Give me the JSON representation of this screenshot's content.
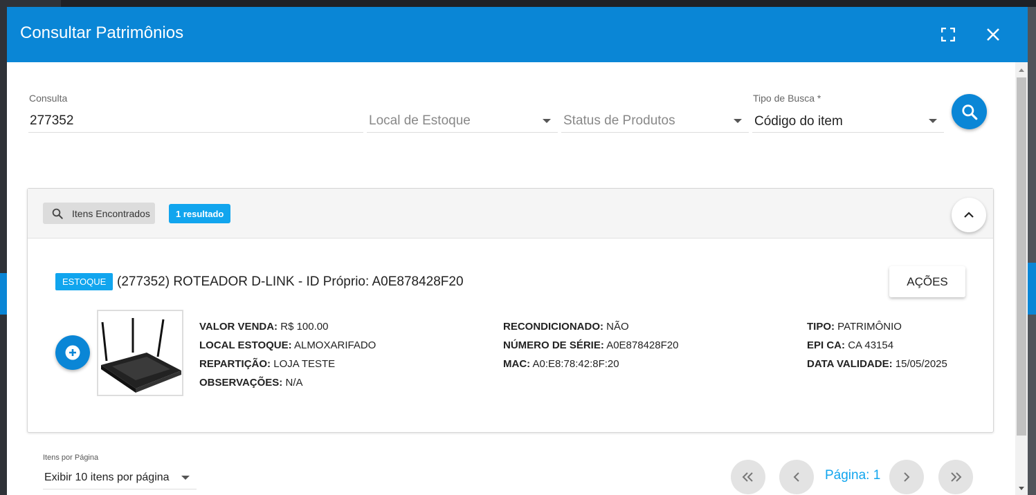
{
  "header": {
    "title": "Consultar Patrimônios",
    "fullscreen_icon": "fullscreen-icon",
    "close_icon": "close-icon",
    "color": "#0a86d6"
  },
  "search": {
    "consulta_label": "Consulta",
    "consulta_value": "277352",
    "local_estoque_placeholder": "Local de Estoque",
    "status_produtos_placeholder": "Status de Produtos",
    "tipo_busca_label": "Tipo de Busca *",
    "tipo_busca_value": "Código do item",
    "search_icon": "search-icon"
  },
  "results": {
    "found_label": "Itens Encontrados",
    "count_label": "1 resultado",
    "accent": "#11a5ee",
    "items": [
      {
        "badge": "ESTOQUE",
        "title": "(277352) ROTEADOR D-LINK - ID Próprio: A0E878428F20",
        "actions_label": "AÇÕES",
        "col1": [
          {
            "key": "VALOR VENDA:",
            "value": "R$ 100.00"
          },
          {
            "key": "LOCAL ESTOQUE:",
            "value": "ALMOXARIFADO"
          },
          {
            "key": "REPARTIÇÃO:",
            "value": "LOJA TESTE"
          },
          {
            "key": "OBSERVAÇÕES:",
            "value": "N/A"
          }
        ],
        "col2": [
          {
            "key": "RECONDICIONADO:",
            "value": "NÃO"
          },
          {
            "key": "NÚMERO DE SÉRIE:",
            "value": "A0E878428F20"
          },
          {
            "key": "MAC:",
            "value": "A0:E8:78:42:8F:20"
          }
        ],
        "col3": [
          {
            "key": "TIPO:",
            "value": "PATRIMÔNIO"
          },
          {
            "key": "EPI CA:",
            "value": "CA 43154"
          },
          {
            "key": "DATA VALIDADE:",
            "value": "15/05/2025"
          }
        ]
      }
    ]
  },
  "pagination": {
    "items_per_page_label": "Itens por Página",
    "items_per_page_value": "Exibir 10 itens por página",
    "page_label": "Página: 1"
  }
}
